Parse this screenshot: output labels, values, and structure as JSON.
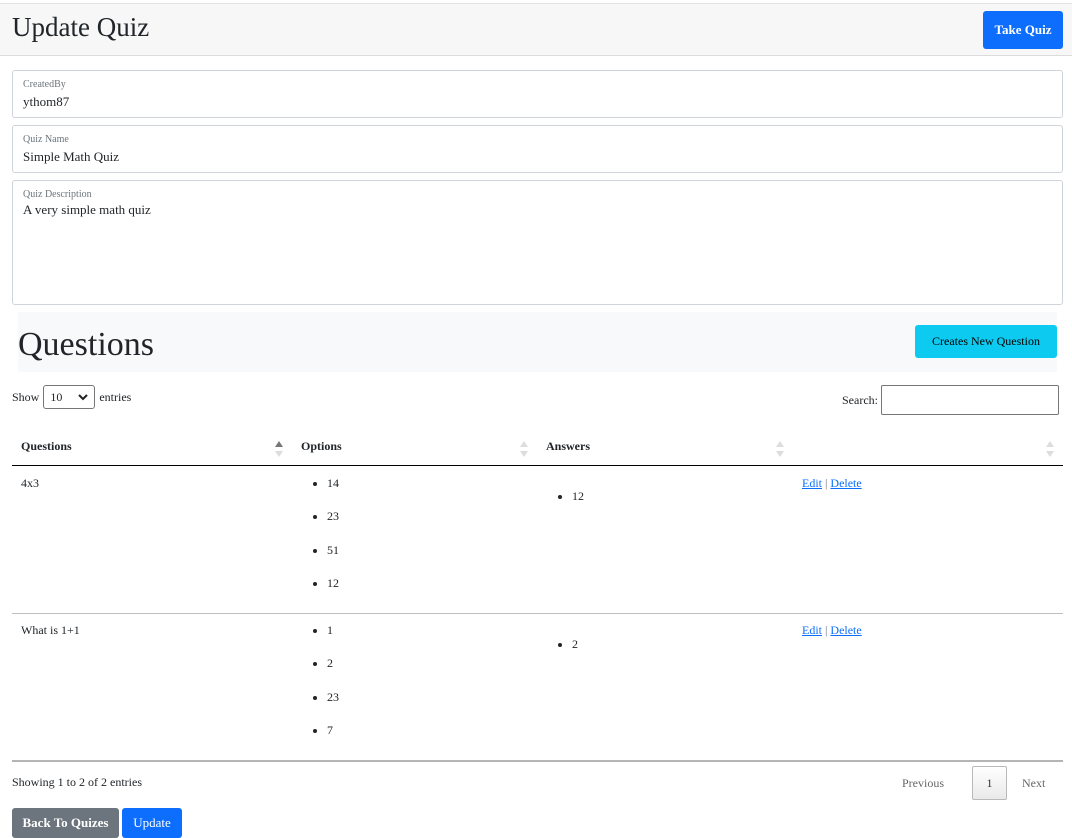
{
  "header": {
    "title": "Update Quiz",
    "take_quiz_label": "Take Quiz"
  },
  "form": {
    "created_by": {
      "label": "CreatedBy",
      "value": "ythom87"
    },
    "quiz_name": {
      "label": "Quiz Name",
      "value": "Simple Math Quiz"
    },
    "quiz_description": {
      "label": "Quiz Description",
      "value": "A very simple math quiz"
    }
  },
  "questions_section": {
    "title": "Questions",
    "new_question_label": "Creates New Question"
  },
  "table_controls": {
    "show_label": "Show",
    "entries_selected": "10",
    "entries_label": "entries",
    "search_label": "Search:",
    "search_value": ""
  },
  "table": {
    "columns": [
      "Questions",
      "Options",
      "Answers",
      ""
    ],
    "rows": [
      {
        "question": "4x3",
        "options": [
          "14",
          "23",
          "51",
          "12"
        ],
        "answers": [
          "12"
        ],
        "edit": "Edit",
        "separator": "|",
        "delete": "Delete"
      },
      {
        "question": "What is 1+1",
        "options": [
          "1",
          "2",
          "23",
          "7"
        ],
        "answers": [
          "2"
        ],
        "edit": "Edit",
        "separator": "|",
        "delete": "Delete"
      }
    ]
  },
  "footer": {
    "info": "Showing 1 to 2 of 2 entries",
    "previous": "Previous",
    "current_page": "1",
    "next": "Next"
  },
  "actions": {
    "back_label": "Back To Quizes",
    "update_label": "Update"
  },
  "colors": {
    "primary": "#0d6efd",
    "info": "#0dcaf0",
    "secondary": "#6c757d"
  }
}
